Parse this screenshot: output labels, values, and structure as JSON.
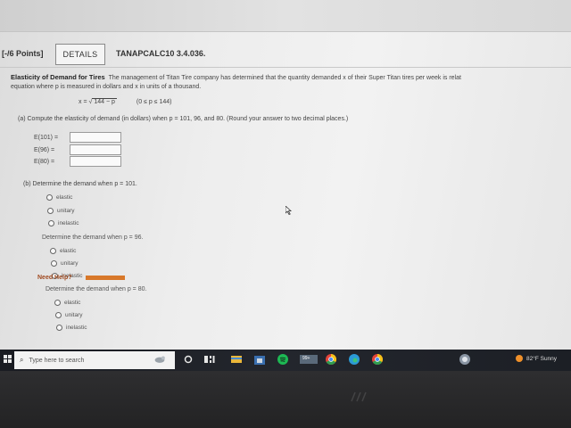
{
  "header": {
    "points": "[-/6 Points]",
    "details_label": "DETAILS",
    "problem_id": "TANAPCALC10 3.4.036."
  },
  "problem": {
    "title": "Elasticity of Demand for Tires",
    "intro_line1": "The management of Titan Tire company has determined that the quantity demanded x of their Super Titan tires per week is relat",
    "intro_line2": "equation where p is measured in dollars and x in units of a thousand.",
    "formula_lhs": "x =",
    "formula_radicand": "144 − p",
    "formula_domain": "(0 ≤ p ≤ 144)"
  },
  "part_a": {
    "prompt": "(a)  Compute the elasticity of demand (in dollars) when p = 101, 96, and 80. (Round your answer to two decimal places.)",
    "rows": [
      {
        "label": "E(101) =",
        "value": ""
      },
      {
        "label": "E(96) =",
        "value": ""
      },
      {
        "label": "E(80) =",
        "value": ""
      }
    ]
  },
  "part_b": {
    "prompt": "(b)  Determine the demand when p = 101.",
    "questions": [
      {
        "label": "",
        "options": [
          "elastic",
          "unitary",
          "inelastic"
        ]
      },
      {
        "label": "Determine the demand when p = 96.",
        "options": [
          "elastic",
          "unitary",
          "inelastic"
        ]
      },
      {
        "label": "Determine the demand when p = 80.",
        "options": [
          "elastic",
          "unitary",
          "inelastic"
        ]
      }
    ]
  },
  "footer": {
    "need_help": "Need Help?"
  },
  "taskbar": {
    "search_placeholder": "Type here to search",
    "badge": "99+",
    "weather": "82°F  Sunny"
  },
  "colors": {
    "accent_orange": "#d8782a",
    "taskbar_bg": "#1f2228"
  }
}
